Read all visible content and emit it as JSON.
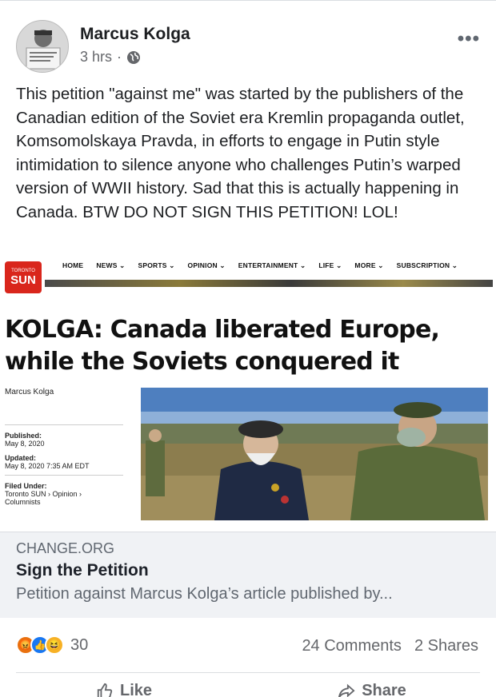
{
  "post": {
    "author": "Marcus Kolga",
    "time": "3 hrs",
    "separator": "·",
    "text": "This petition \"against me\" was started by the publishers of the Canadian edition of the Soviet era Kremlin propaganda outlet, Komsomolskaya Pravda, in efforts to engage in Putin style intimidation to silence anyone who challenges Putin’s warped version of WWII history. Sad that this is actually happening in Canada. BTW DO NOT SIGN THIS PETITION! LOL!",
    "more_label": "•••"
  },
  "article": {
    "logo_small": "TORONTO",
    "logo": "SUN",
    "nav": [
      "HOME",
      "NEWS ⌄",
      "SPORTS ⌄",
      "OPINION ⌄",
      "ENTERTAINMENT ⌄",
      "LIFE ⌄",
      "MORE ⌄",
      "SUBSCRIPTION ⌄"
    ],
    "headline_line1": "KOLGA: Canada liberated Europe,",
    "headline_line2": "while the Soviets conquered it",
    "byline": "Marcus Kolga",
    "published_label": "Published:",
    "published": "May 8, 2020",
    "updated_label": "Updated:",
    "updated": "May 8, 2020 7:35 AM EDT",
    "filed_label": "Filed Under:",
    "filed": "Toronto SUN  ›  Opinion  ›",
    "filed2": "Columnists"
  },
  "preview": {
    "domain": "CHANGE.ORG",
    "title": "Sign the Petition",
    "description": "Petition against Marcus Kolga’s article published by..."
  },
  "engagement": {
    "reaction_count": "30",
    "comments": "24 Comments",
    "shares": "2 Shares"
  },
  "actions": {
    "like": "Like",
    "share": "Share"
  },
  "colors": {
    "facebook_blue": "#1877f2",
    "sun_red": "#d9261c",
    "secondary_text": "#65676b"
  }
}
